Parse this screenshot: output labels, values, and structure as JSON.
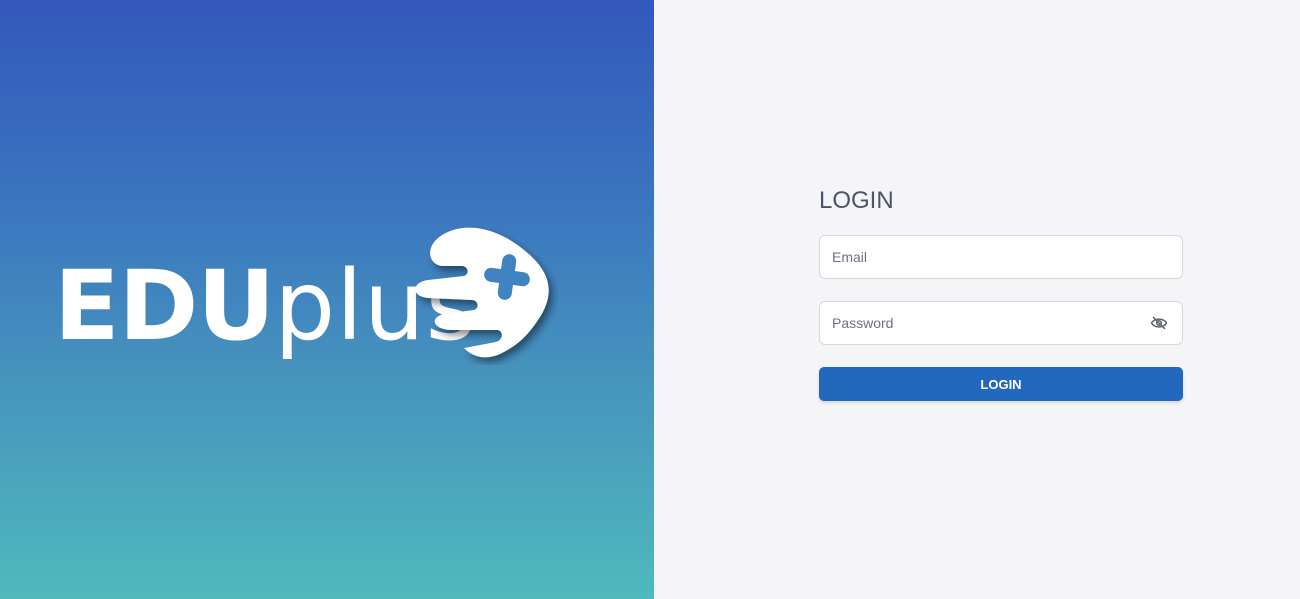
{
  "brand": {
    "logo_text_bold": "EDU",
    "logo_text_light": "plus",
    "logo_icon": "eduplus-emblem-icon",
    "gradient_colors": [
      "#3358bb",
      "#4fb9bd"
    ]
  },
  "login": {
    "title": "LOGIN",
    "email_placeholder": "Email",
    "email_value": "",
    "password_placeholder": "Password",
    "password_value": "",
    "password_toggle_icon": "eye-off-icon",
    "submit_label": "LOGIN",
    "accent_color": "#2268bf"
  }
}
